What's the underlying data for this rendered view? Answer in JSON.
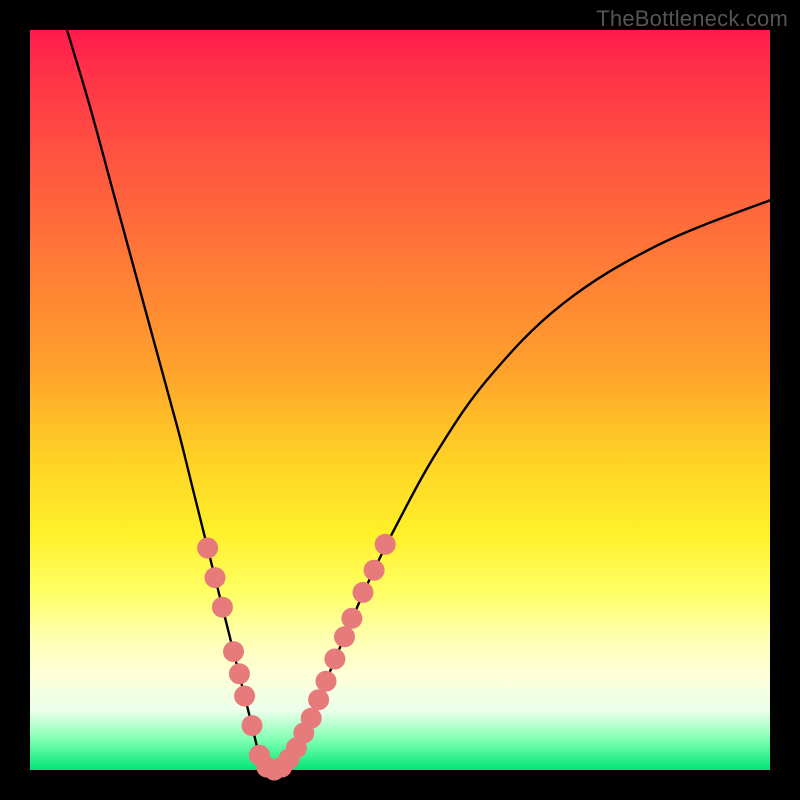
{
  "watermark": {
    "text": "TheBottleneck.com"
  },
  "colors": {
    "background": "#000000",
    "curve": "#000000",
    "dot_fill": "#e77a7a",
    "dot_stroke": "#d46969",
    "gradient_stops": [
      "#ff1a4d",
      "#ff5640",
      "#ffa22c",
      "#fff02a",
      "#ffffb0",
      "#00e676"
    ]
  },
  "chart_data": {
    "type": "line",
    "title": "",
    "xlabel": "",
    "ylabel": "",
    "xlim": [
      0,
      100
    ],
    "ylim": [
      0,
      100
    ],
    "series": [
      {
        "name": "bottleneck-curve",
        "x": [
          5,
          8,
          11,
          14,
          17,
          20,
          22,
          24,
          26,
          27.5,
          29,
          30,
          31,
          32,
          33,
          34.5,
          36,
          38,
          40,
          42.5,
          46,
          50,
          55,
          62,
          72,
          85,
          100
        ],
        "y": [
          100,
          90,
          79,
          68,
          57,
          46,
          38,
          30,
          22,
          16,
          10,
          6,
          2,
          0,
          0,
          1,
          3,
          7,
          12,
          18,
          26,
          34,
          43,
          53,
          63,
          71,
          77
        ]
      }
    ],
    "dots_left": {
      "series": "bottleneck-curve",
      "points": [
        {
          "x": 24.0,
          "y": 30
        },
        {
          "x": 25.0,
          "y": 26
        },
        {
          "x": 26.0,
          "y": 22
        },
        {
          "x": 27.5,
          "y": 16
        },
        {
          "x": 28.3,
          "y": 13
        },
        {
          "x": 29.0,
          "y": 10
        },
        {
          "x": 30.0,
          "y": 6
        },
        {
          "x": 31.0,
          "y": 2
        },
        {
          "x": 32.0,
          "y": 0.4
        },
        {
          "x": 33.0,
          "y": 0
        },
        {
          "x": 34.0,
          "y": 0.4
        }
      ]
    },
    "dots_right": {
      "series": "bottleneck-curve",
      "points": [
        {
          "x": 35.0,
          "y": 1.5
        },
        {
          "x": 36.0,
          "y": 3
        },
        {
          "x": 37.0,
          "y": 5
        },
        {
          "x": 38.0,
          "y": 7
        },
        {
          "x": 39.0,
          "y": 9.5
        },
        {
          "x": 40.0,
          "y": 12
        },
        {
          "x": 41.2,
          "y": 15
        },
        {
          "x": 42.5,
          "y": 18
        },
        {
          "x": 43.5,
          "y": 20.5
        },
        {
          "x": 45.0,
          "y": 24
        },
        {
          "x": 46.5,
          "y": 27
        },
        {
          "x": 48.0,
          "y": 30.5
        }
      ]
    }
  }
}
